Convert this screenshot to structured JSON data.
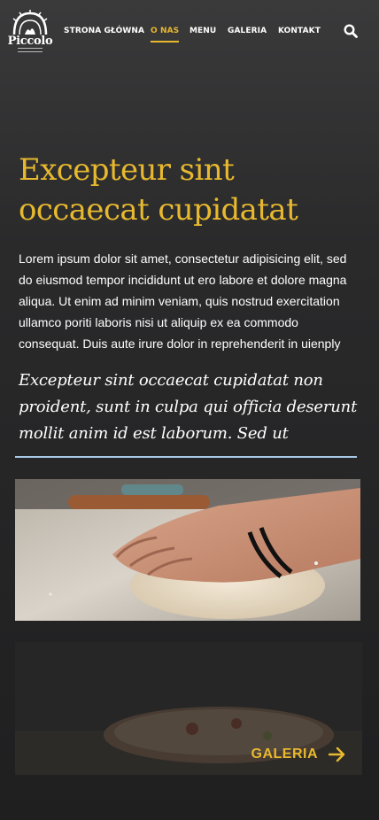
{
  "brand": {
    "name": "Piccolo",
    "accent": "#e8b92e"
  },
  "nav": {
    "items": [
      {
        "label": "STRONA GŁÓWNA"
      },
      {
        "label": "O NAS"
      },
      {
        "label": "MENU"
      },
      {
        "label": "GALERIA"
      },
      {
        "label": "KONTAKT"
      }
    ],
    "active": "O NAS",
    "search_icon": "search-icon"
  },
  "hero": {
    "title": "Excepteur sint occaecat cupidatat",
    "body": "Lorem ipsum dolor sit amet, consectetur adipisicing elit, sed do eiusmod tempor incididunt ut ero labore et dolore magna aliqua. Ut enim ad minim veniam, quis nostrud exercitation ullamco poriti laboris nisi ut aliquip ex ea commodo consequat. Duis aute irure dolor in reprehenderit in uienply",
    "quote": "Excepteur sint occaecat cupidatat non proident, sunt in culpa qui officia deserunt mollit anim id est laborum. Sed ut"
  },
  "gallery": {
    "label": "GALERIA",
    "arrow_icon": "arrow-right-icon"
  }
}
